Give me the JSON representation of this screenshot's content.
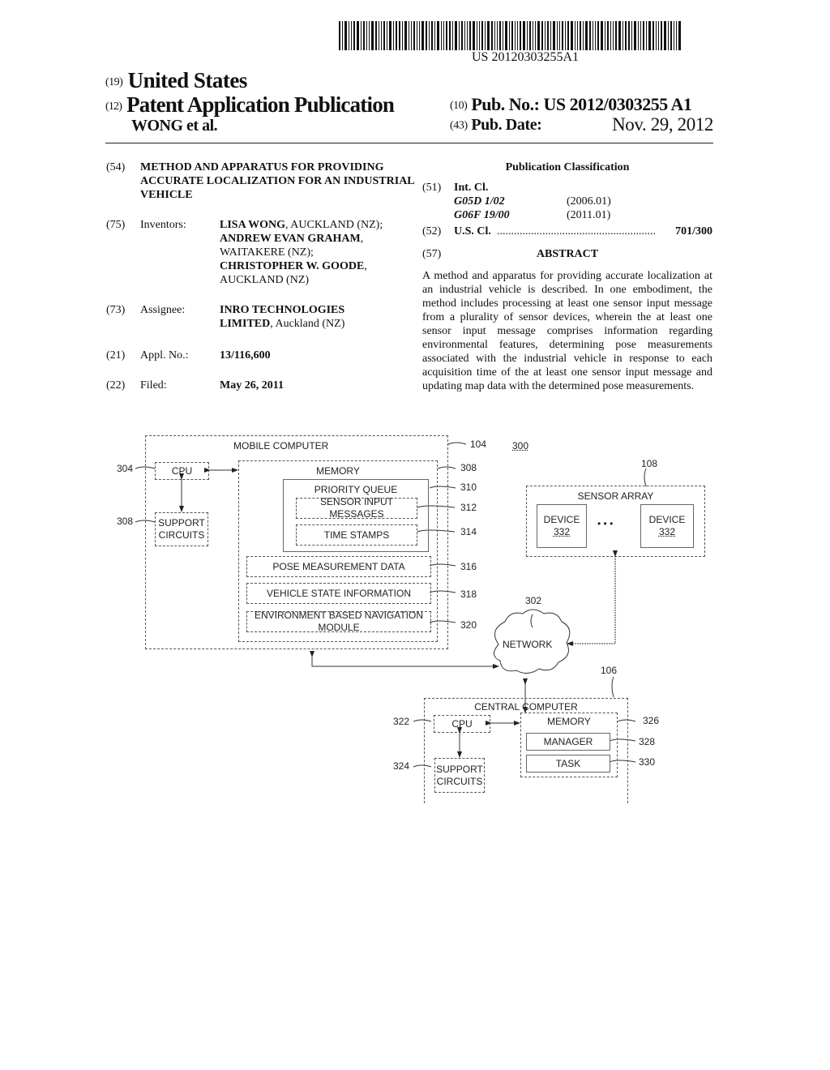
{
  "header": {
    "barcode_text": "US 20120303255A1",
    "country_code": "(19)",
    "country": "United States",
    "pubtype_code": "(12)",
    "pubtype": "Patent Application Publication",
    "inventors_short": "WONG et al.",
    "pubno_code": "(10)",
    "pubno_label": "Pub. No.:",
    "pubno": "US 2012/0303255 A1",
    "pubdate_code": "(43)",
    "pubdate_label": "Pub. Date:",
    "pubdate": "Nov. 29, 2012"
  },
  "left_fields": {
    "title": {
      "code": "(54)",
      "text": "METHOD AND APPARATUS FOR PROVIDING ACCURATE LOCALIZATION FOR AN INDUSTRIAL VEHICLE"
    },
    "inventors": {
      "code": "(75)",
      "label": "Inventors:",
      "people": [
        {
          "name": "LISA WONG",
          "place": ", AUCKLAND (NZ);"
        },
        {
          "name": "ANDREW EVAN GRAHAM",
          "place": ", WAITAKERE (NZ);"
        },
        {
          "name": "CHRISTOPHER W. GOODE",
          "place": ", AUCKLAND (NZ)"
        }
      ]
    },
    "assignee": {
      "code": "(73)",
      "label": "Assignee:",
      "name": "INRO TECHNOLOGIES LIMITED",
      "place": ", Auckland (NZ)"
    },
    "appl": {
      "code": "(21)",
      "label": "Appl. No.:",
      "value": "13/116,600"
    },
    "filed": {
      "code": "(22)",
      "label": "Filed:",
      "value": "May 26, 2011"
    }
  },
  "classification": {
    "heading": "Publication Classification",
    "int_code": "(51)",
    "int_label": "Int. Cl.",
    "int_classes": [
      {
        "cls": "G05D 1/02",
        "ver": "(2006.01)"
      },
      {
        "cls": "G06F 19/00",
        "ver": "(2011.01)"
      }
    ],
    "us_code": "(52)",
    "us_label": "U.S. Cl.",
    "us_dots": "........................................................",
    "us_value": "701/300"
  },
  "abstract": {
    "code": "(57)",
    "heading": "ABSTRACT",
    "text": "A method and apparatus for providing accurate localization at an industrial vehicle is described. In one embodiment, the method includes processing at least one sensor input message from a plurality of sensor devices, wherein the at least one sensor input message comprises information regarding environmental features, determining pose measurements associated with the industrial vehicle in response to each acquisition time of the at least one sensor input message and updating map data with the determined pose measurements."
  },
  "diagram": {
    "figure_ref": "300",
    "mobile_computer": {
      "label": "MOBILE COMPUTER",
      "ref": "104"
    },
    "cpu": {
      "label": "CPU",
      "ref": "304"
    },
    "support": {
      "label1": "SUPPORT",
      "label2": "CIRCUITS",
      "ref": "308"
    },
    "memory": {
      "label": "MEMORY",
      "ref": "308"
    },
    "priority_queue": {
      "label": "PRIORITY QUEUE",
      "ref": "310"
    },
    "sensor_msgs": {
      "label": "SENSOR INPUT MESSAGES",
      "ref": "312"
    },
    "time_stamps": {
      "label": "TIME STAMPS",
      "ref": "314"
    },
    "pose": {
      "label": "POSE MEASUREMENT DATA",
      "ref": "316"
    },
    "vehicle_state": {
      "label": "VEHICLE STATE INFORMATION",
      "ref": "318"
    },
    "env_nav": {
      "label": "ENVIRONMENT BASED NAVIGATION MODULE",
      "ref": "320"
    },
    "sensor_array": {
      "label": "SENSOR ARRAY",
      "ref": "108"
    },
    "device": {
      "label": "DEVICE",
      "ref": "332"
    },
    "ellipsis": "•   •   •",
    "network": {
      "label": "NETWORK",
      "ref": "302"
    },
    "central": {
      "label": "CENTRAL COMPUTER",
      "ref": "106"
    },
    "c_cpu": {
      "label": "CPU",
      "ref": "322"
    },
    "c_support": {
      "label1": "SUPPORT",
      "label2": "CIRCUITS",
      "ref": "324"
    },
    "c_memory": {
      "label": "MEMORY",
      "ref": "326"
    },
    "manager": {
      "label": "MANAGER",
      "ref": "328"
    },
    "task": {
      "label": "TASK",
      "ref": "330"
    }
  }
}
